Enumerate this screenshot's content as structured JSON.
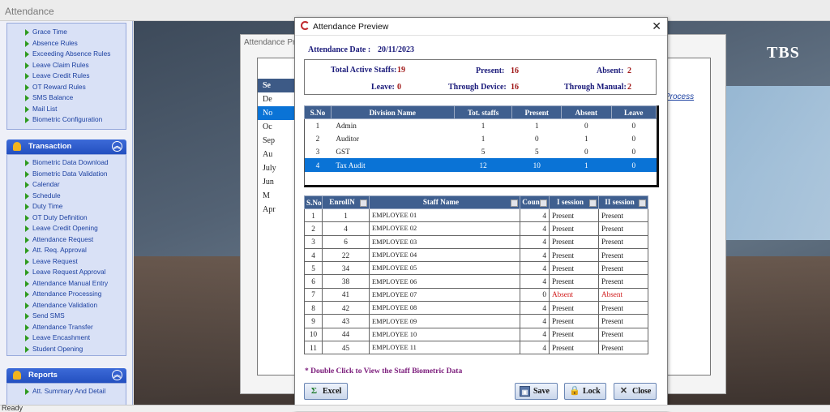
{
  "app": {
    "title": "Attendance",
    "status": "Ready",
    "brand": "TBS"
  },
  "sidebar": {
    "top_items": [
      "Grace Time",
      "Absence Rules",
      "Exceeding Absence Rules",
      "Leave Claim  Rules",
      "Leave Credit Rules",
      "OT Reward Rules",
      "SMS Balance",
      "Mail List",
      "Biometric Configuration"
    ],
    "sections": [
      {
        "title": "Transaction",
        "items": [
          "Biometric Data Download",
          "Biometric Data Validation",
          "Calendar",
          "Schedule",
          "Duty Time",
          "OT Duty Definition",
          "Leave Credit Opening",
          "Attendance Request",
          "Att. Req. Approval",
          "Leave Request",
          "Leave Request Approval",
          "Attendance Manual Entry",
          "Attendance Processing",
          "Attendance Validation",
          "Send SMS",
          "Attendance Transfer",
          "Leave Encashment",
          "Student Opening"
        ]
      },
      {
        "title": "Reports",
        "items": [
          "Att. Summary And Detail"
        ]
      }
    ]
  },
  "background_window": {
    "title": "Attendance Pro",
    "list_header": "Se",
    "months": [
      "De",
      "No",
      "Oc",
      "Sep",
      "Au",
      "July",
      "Jun",
      "M",
      "Apr"
    ],
    "process_link": "Process"
  },
  "dialog": {
    "title": "Attendance Preview",
    "date_label": "Attendance Date :",
    "date_value": "20/11/2023",
    "summary": {
      "total_label": "Total Active Staffs:",
      "total_value": "19",
      "present_label": "Present:",
      "present_value": "16",
      "absent_label": "Absent:",
      "absent_value": "2",
      "leave_label": "Leave:",
      "leave_value": "0",
      "device_label": "Through Device:",
      "device_value": "16",
      "manual_label": "Through Manual:",
      "manual_value": "2"
    },
    "division_table": {
      "headers": [
        "S.No",
        "Division Name",
        "Tot. staffs",
        "Present",
        "Absent",
        "Leave"
      ],
      "rows": [
        [
          "1",
          "Admin",
          "1",
          "1",
          "0",
          "0"
        ],
        [
          "2",
          "Auditor",
          "1",
          "0",
          "1",
          "0"
        ],
        [
          "3",
          "GST",
          "5",
          "5",
          "0",
          "0"
        ],
        [
          "4",
          "Tax Audit",
          "12",
          "10",
          "1",
          "0"
        ]
      ],
      "selected_row": 3
    },
    "staff_table": {
      "headers": [
        "S.No",
        "EnrollN",
        "Staff Name",
        "Coun",
        "I session",
        "II session"
      ],
      "rows": [
        [
          "1",
          "1",
          "EMPLOYEE 01",
          "4",
          "Present",
          "Present"
        ],
        [
          "2",
          "4",
          "EMPLOYEE 02",
          "4",
          "Present",
          "Present"
        ],
        [
          "3",
          "6",
          "EMPLOYEE 03",
          "4",
          "Present",
          "Present"
        ],
        [
          "4",
          "22",
          "EMPLOYEE 04",
          "4",
          "Present",
          "Present"
        ],
        [
          "5",
          "34",
          "EMPLOYEE 05",
          "4",
          "Present",
          "Present"
        ],
        [
          "6",
          "38",
          "EMPLOYEE 06",
          "4",
          "Present",
          "Present"
        ],
        [
          "7",
          "41",
          "EMPLOYEE 07",
          "0",
          "Absent",
          "Absent"
        ],
        [
          "8",
          "42",
          "EMPLOYEE 08",
          "4",
          "Present",
          "Present"
        ],
        [
          "9",
          "43",
          "EMPLOYEE 09",
          "4",
          "Present",
          "Present"
        ],
        [
          "10",
          "44",
          "EMPLOYEE 10",
          "4",
          "Present",
          "Present"
        ],
        [
          "11",
          "45",
          "EMPLOYEE 11",
          "4",
          "Present",
          "Present"
        ]
      ]
    },
    "hint": "* Double Click to View the Staff Biometric Data",
    "buttons": {
      "excel": "Excel",
      "save": "Save",
      "lock": "Lock",
      "close": "Close"
    },
    "icons": {
      "excel": "sigma-icon",
      "save": "floppy-icon",
      "lock": "lock-icon",
      "close": "close-icon"
    }
  },
  "colors": {
    "header_bg": "#3f5f8f",
    "selected_row": "#0a73d6",
    "absent": "#d11c1c",
    "label": "#1a1a7a",
    "value": "#a01818"
  }
}
